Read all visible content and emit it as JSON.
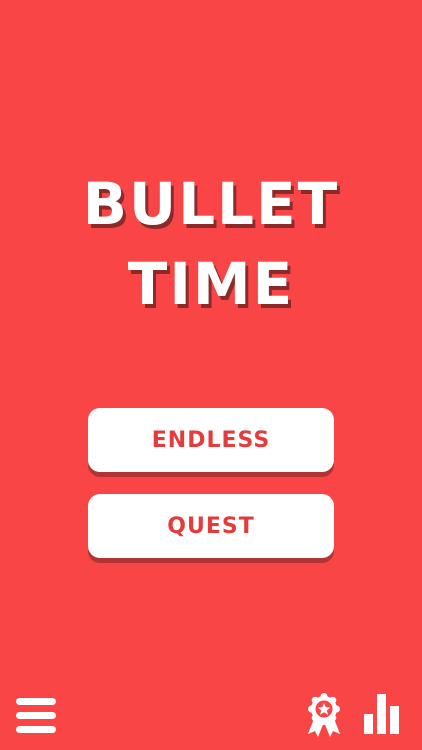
{
  "title": {
    "line1": "BULLET",
    "line2": "TIME"
  },
  "menu": {
    "endless_label": "ENDLESS",
    "quest_label": "QUEST"
  },
  "icons": {
    "menu": "hamburger-menu-icon",
    "achievements": "award-ribbon-icon",
    "leaderboard": "bar-chart-icon"
  },
  "colors": {
    "background": "#f94545",
    "button_bg": "#ffffff",
    "button_text": "#e43c3c",
    "title_shadow": "#8a2a2a"
  }
}
